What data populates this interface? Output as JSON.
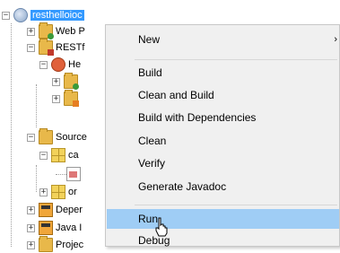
{
  "tree": {
    "project": "resthelloioc",
    "items": [
      {
        "label": "Web P",
        "icon": "web-pages-folder-icon"
      },
      {
        "label": "RESTf",
        "icon": "restful-services-folder-icon"
      },
      {
        "label": "He",
        "icon": "service-icon"
      },
      {
        "label": "",
        "icon": "folder-icon"
      },
      {
        "label": "",
        "icon": "folder-icon"
      },
      {
        "label": "Source",
        "icon": "source-packages-folder-icon"
      },
      {
        "label": "ca",
        "icon": "package-icon"
      },
      {
        "label": "",
        "icon": "java-file-icon"
      },
      {
        "label": "or",
        "icon": "package-icon"
      },
      {
        "label": "Deper",
        "icon": "dependencies-jar-icon"
      },
      {
        "label": "Java I",
        "icon": "java-dependencies-jar-icon"
      },
      {
        "label": "Projec",
        "icon": "project-files-jar-icon"
      }
    ]
  },
  "menu": {
    "items": [
      {
        "label": "New",
        "has_submenu": true
      },
      {
        "label": "Build"
      },
      {
        "label": "Clean and Build"
      },
      {
        "label": "Build with Dependencies"
      },
      {
        "label": "Clean"
      },
      {
        "label": "Verify"
      },
      {
        "label": "Generate Javadoc"
      },
      {
        "label": "Run",
        "highlighted": true
      },
      {
        "label": "Debug"
      }
    ],
    "submenu_arrow": "›"
  },
  "colors": {
    "selection": "#3399ff",
    "menu_background": "#f0f0f0",
    "menu_highlight": "#9fcdf5"
  }
}
